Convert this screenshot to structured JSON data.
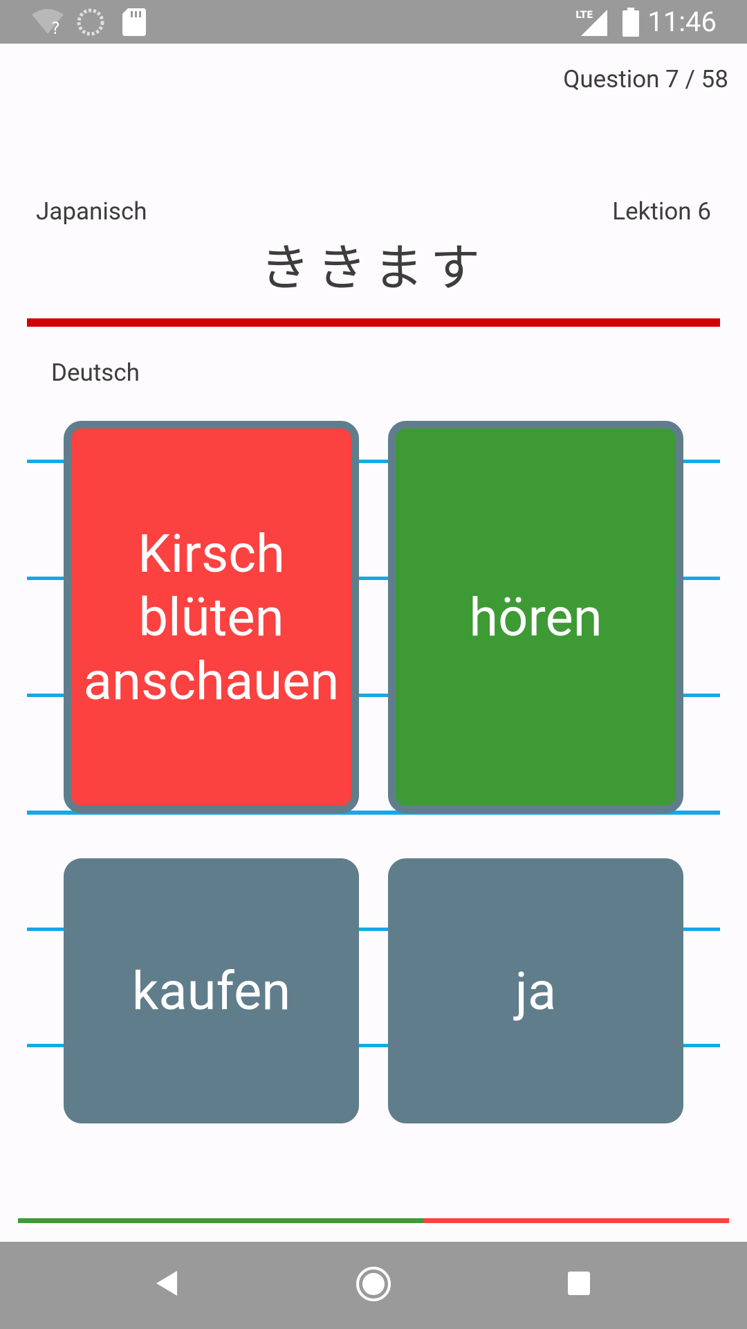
{
  "status_bar": {
    "time": "11:46",
    "network_label": "LTE",
    "icons": [
      "wifi-question-icon",
      "sync-icon",
      "sd-card-icon",
      "lte-signal-icon",
      "battery-icon"
    ]
  },
  "quiz": {
    "question_counter": "Question 7 / 58",
    "source_language": "Japanisch",
    "lesson": "Lektion 6",
    "word": "ききます",
    "target_language": "Deutsch",
    "answers": [
      {
        "label": "Kirsch\nblüten\nanschauen",
        "state": "wrong"
      },
      {
        "label": "hören",
        "state": "correct"
      },
      {
        "label": "kaufen",
        "state": "neutral"
      },
      {
        "label": "ja",
        "state": "neutral"
      }
    ],
    "progress_correct_fraction": 0.57
  },
  "colors": {
    "wrong": "#fc4141",
    "correct": "#3e9a35",
    "neutral": "#607d8b",
    "divider": "#d10000",
    "rule_lines": "#14a9e6",
    "status_bar": "#9a9a9a"
  },
  "nav_bar": {
    "icons": [
      "back-icon",
      "home-icon",
      "recents-icon"
    ]
  }
}
